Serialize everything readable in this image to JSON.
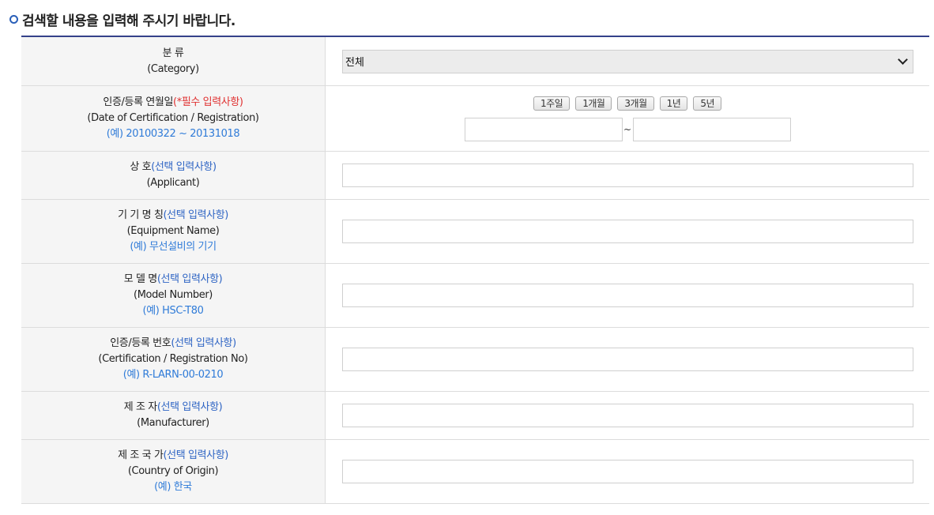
{
  "heading": "검색할 내용을 입력해 주시기 바랍니다.",
  "colors": {
    "accent": "#34418a",
    "bullet": "#2a5fb8",
    "required": "#e03030",
    "optional": "#2f65c4",
    "example": "#2f7bd8"
  },
  "category": {
    "label": "분 류",
    "label_en": "(Category)",
    "selected": "전체"
  },
  "date": {
    "label": "인증/등록 연월일",
    "required_note": "(*필수 입력사항)",
    "label_en": "(Date of Certification / Registration)",
    "example": "(예) 20100322 ~ 20131018",
    "quick_buttons": [
      "1주일",
      "1개월",
      "3개월",
      "1년",
      "5년"
    ],
    "separator": "~"
  },
  "applicant": {
    "label": "상 호",
    "optional_note": "(선택 입력사항)",
    "label_en": "(Applicant)"
  },
  "equipment": {
    "label": "기 기 명 칭",
    "optional_note": "(선택 입력사항)",
    "label_en": "(Equipment Name)",
    "example": "(예) 무선설비의 기기"
  },
  "model": {
    "label": "모 델 명",
    "optional_note": "(선택 입력사항)",
    "label_en": "(Model Number)",
    "example": "(예) HSC-T80"
  },
  "cert_no": {
    "label": "인증/등록 번호",
    "optional_note": "(선택 입력사항)",
    "label_en": "(Certification / Registration No)",
    "example": "(예) R-LARN-00-0210"
  },
  "manufacturer": {
    "label": "제 조 자",
    "optional_note": "(선택 입력사항)",
    "label_en": "(Manufacturer)"
  },
  "country": {
    "label": "제 조 국 가",
    "optional_note": "(선택 입력사항)",
    "label_en": "(Country of Origin)",
    "example": "(예) 한국"
  }
}
